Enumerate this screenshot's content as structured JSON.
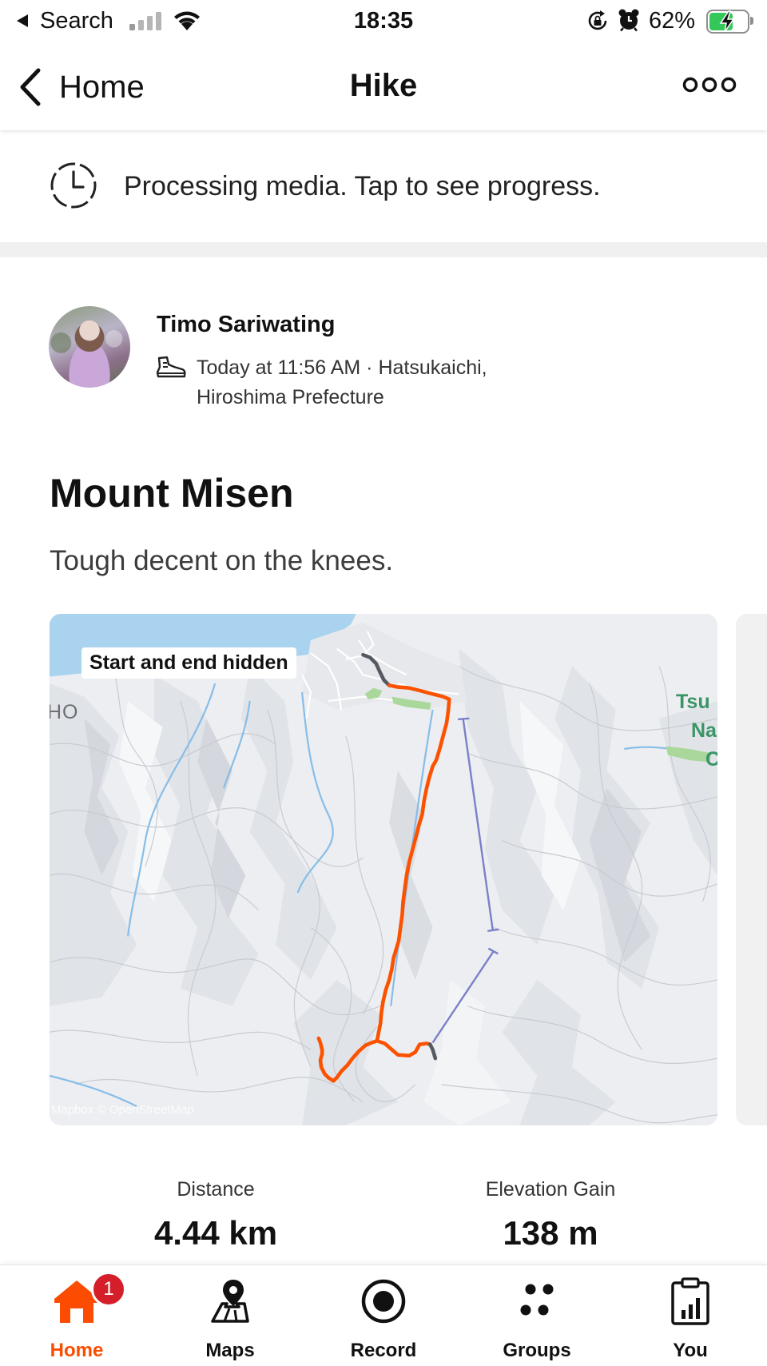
{
  "status_bar": {
    "back_app_label": "Search",
    "time": "18:35",
    "battery_text": "62%",
    "icons": [
      "back-triangle-icon",
      "cellular-signal-icon",
      "wifi-icon",
      "rotation-lock-icon",
      "alarm-icon",
      "battery-charging-icon"
    ]
  },
  "nav": {
    "back_label": "Home",
    "title": "Hike",
    "icons": {
      "back": "chevron-left-icon",
      "more": "more-options-icon"
    }
  },
  "banner": {
    "text": "Processing media. Tap to see progress.",
    "icon": "clock-icon"
  },
  "activity": {
    "athlete_name": "Timo Sariwating",
    "sport_icon": "hiking-boot-icon",
    "meta_line1": "Today at 11:56 AM · Hatsukaichi,",
    "meta_line2": "Hiroshima Prefecture",
    "title": "Mount Misen",
    "description": "Tough decent on the knees."
  },
  "map": {
    "privacy_label": "Start and end hidden",
    "place_label_left": "HO",
    "place_labels_right": [
      "Tsu",
      "Na",
      "C"
    ],
    "attribution": "Mapbox © OpenStreetMap"
  },
  "stats": [
    {
      "label": "Distance",
      "value": "4.44 km"
    },
    {
      "label": "Elevation Gain",
      "value": "138 m"
    }
  ],
  "tab_bar": {
    "items": [
      {
        "label": "Home",
        "icon": "home-icon",
        "active": true,
        "badge": "1"
      },
      {
        "label": "Maps",
        "icon": "maps-icon",
        "active": false
      },
      {
        "label": "Record",
        "icon": "record-icon",
        "active": false
      },
      {
        "label": "Groups",
        "icon": "groups-icon",
        "active": false
      },
      {
        "label": "You",
        "icon": "profile-stats-icon",
        "active": false
      }
    ]
  },
  "colors": {
    "accent": "#fc4c02",
    "route": "#fc5200",
    "badge": "#d41f2b",
    "battery_fill": "#34c759",
    "ropeway": "#7b80c8",
    "water": "#aad3ef"
  }
}
